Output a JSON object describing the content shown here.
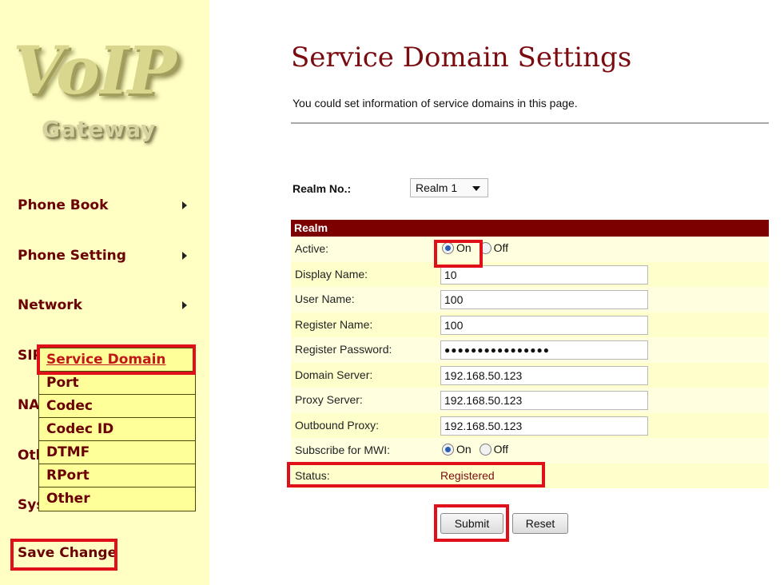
{
  "sidebar": {
    "logo_title": "VoIP",
    "logo_subtitle": "Gateway",
    "menu": [
      {
        "label": "Phone Book"
      },
      {
        "label": "Phone Setting"
      },
      {
        "label": "Network"
      },
      {
        "label": "SIP"
      },
      {
        "label": "NAT"
      },
      {
        "label": "Other"
      },
      {
        "label": "System"
      }
    ],
    "submenu": [
      {
        "label": "Service Domain"
      },
      {
        "label": "Port"
      },
      {
        "label": "Codec"
      },
      {
        "label": "Codec ID"
      },
      {
        "label": "DTMF"
      },
      {
        "label": "RPort"
      },
      {
        "label": "Other"
      }
    ],
    "save_change": "Save Change"
  },
  "page": {
    "title": "Service Domain Settings",
    "description": "You could set information of service domains in this page."
  },
  "realm_select": {
    "label": "Realm No.:",
    "value": "Realm 1"
  },
  "realm": {
    "header": "Realm",
    "active": {
      "label": "Active:",
      "on": "On",
      "off": "Off",
      "selected": "On"
    },
    "display_name": {
      "label": "Display Name:",
      "value": "10"
    },
    "user_name": {
      "label": "User Name:",
      "value": "100"
    },
    "register_name": {
      "label": "Register Name:",
      "value": "100"
    },
    "register_password": {
      "label": "Register Password:",
      "value": "●●●●●●●●●●●●●●●●"
    },
    "domain_server": {
      "label": "Domain Server:",
      "value": "192.168.50.123"
    },
    "proxy_server": {
      "label": "Proxy Server:",
      "value": "192.168.50.123"
    },
    "outbound_proxy": {
      "label": "Outbound Proxy:",
      "value": "192.168.50.123"
    },
    "subscribe_mwi": {
      "label": "Subscribe for MWI:",
      "on": "On",
      "off": "Off",
      "selected": "On"
    },
    "status": {
      "label": "Status:",
      "value": "Registered"
    }
  },
  "buttons": {
    "submit": "Submit",
    "reset": "Reset"
  },
  "colors": {
    "sidebar_bg": "#ffffc4",
    "header_bg": "#7c0000",
    "highlight": "#e0101a",
    "title": "#7a0c10"
  }
}
